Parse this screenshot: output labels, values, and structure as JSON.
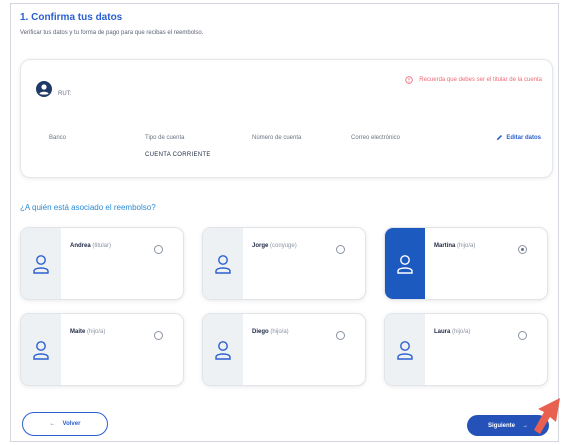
{
  "header": {
    "title": "1. Confirma tus datos",
    "subtitle": "Verificar tus datos y tu forma de pago para que recibas el reembolso."
  },
  "data_card": {
    "rut_label": "RUT:",
    "warning": "Recuerda que debes ser el titular de la cuenta",
    "fields": {
      "banco": "Banco",
      "tipo_cuenta": "Tipo de cuenta",
      "numero_cuenta": "Número de cuenta",
      "correo": "Correo electrónico"
    },
    "tipo_cuenta_value": "CUENTA CORRIENTE",
    "edit_label": "Editar datos"
  },
  "question": "¿A quién está asociado el reembolso?",
  "people": [
    {
      "name": "Andrea",
      "relation": "(titular)",
      "selected": false
    },
    {
      "name": "Jorge",
      "relation": "(conyuge)",
      "selected": false
    },
    {
      "name": "Martina",
      "relation": "(hijo/a)",
      "selected": true
    },
    {
      "name": "Maite",
      "relation": "(hijo/a)",
      "selected": false
    },
    {
      "name": "Diego",
      "relation": "(hijo/a)",
      "selected": false
    },
    {
      "name": "Laura",
      "relation": "(hijo/a)",
      "selected": false
    }
  ],
  "footer": {
    "back_label": "Volver",
    "next_label": "Siguiente"
  },
  "colors": {
    "primary": "#2a5fd0",
    "selected_panel": "#1d5ac0",
    "warning": "#ec6a78",
    "pointer": "#e8604f"
  }
}
